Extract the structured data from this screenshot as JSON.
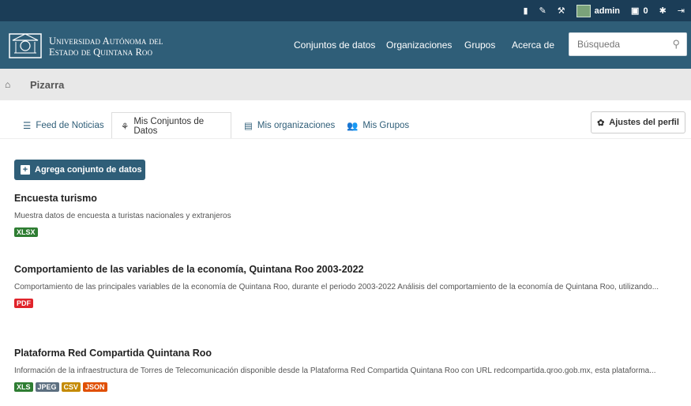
{
  "topbar": {
    "user": "admin",
    "count": "0",
    "icons": [
      "building-icon",
      "pencil-icon",
      "hammer-icon",
      "dashboard-icon",
      "gear-icon",
      "sign-out-icon"
    ]
  },
  "header": {
    "brand_line1": "Universidad Autónoma del",
    "brand_line2": "Estado de Quintana Roo",
    "nav": [
      "Conjuntos de datos",
      "Organizaciones",
      "Grupos",
      "Acerca de"
    ],
    "search_placeholder": "Búsqueda"
  },
  "breadcrumb": {
    "current": "Pizarra"
  },
  "tabs": [
    {
      "label": "Feed de Noticias",
      "icon": "list-icon",
      "active": false
    },
    {
      "label": "Mis Conjuntos de Datos",
      "icon": "sitemap-icon",
      "active": true
    },
    {
      "label": "Mis organizaciones",
      "icon": "building-icon",
      "active": false
    },
    {
      "label": "Mis Grupos",
      "icon": "users-icon",
      "active": false
    }
  ],
  "profile_button": "Ajustes del perfil",
  "add_button": "Agrega conjunto de datos",
  "datasets": [
    {
      "title": "Encuesta turismo",
      "description": "Muestra datos de encuesta a turistas nacionales y extranjeros",
      "formats": [
        {
          "label": "XLSX",
          "color": "#2e7d32"
        }
      ]
    },
    {
      "title": "Comportamiento de las variables de la economía, Quintana Roo 2003-2022",
      "description": "Comportamiento de las principales variables de la economía de Quintana Roo, durante el periodo 2003-2022 Análisis del comportamiento de la economía de Quintana Roo, utilizando...",
      "formats": [
        {
          "label": "PDF",
          "color": "#e0242b"
        }
      ]
    },
    {
      "title": "Plataforma Red Compartida Quintana Roo",
      "description": "Información de la infraestructura de Torres de Telecomunicación disponible desde la Plataforma Red Compartida Quintana Roo con URL redcompartida.qroo.gob.mx, esta plataforma...",
      "formats": [
        {
          "label": "XLS",
          "color": "#2e7d32"
        },
        {
          "label": "JPEG",
          "color": "#5c6f80"
        },
        {
          "label": "CSV",
          "color": "#c48a00"
        },
        {
          "label": "JSON",
          "color": "#e04f00"
        }
      ]
    }
  ]
}
